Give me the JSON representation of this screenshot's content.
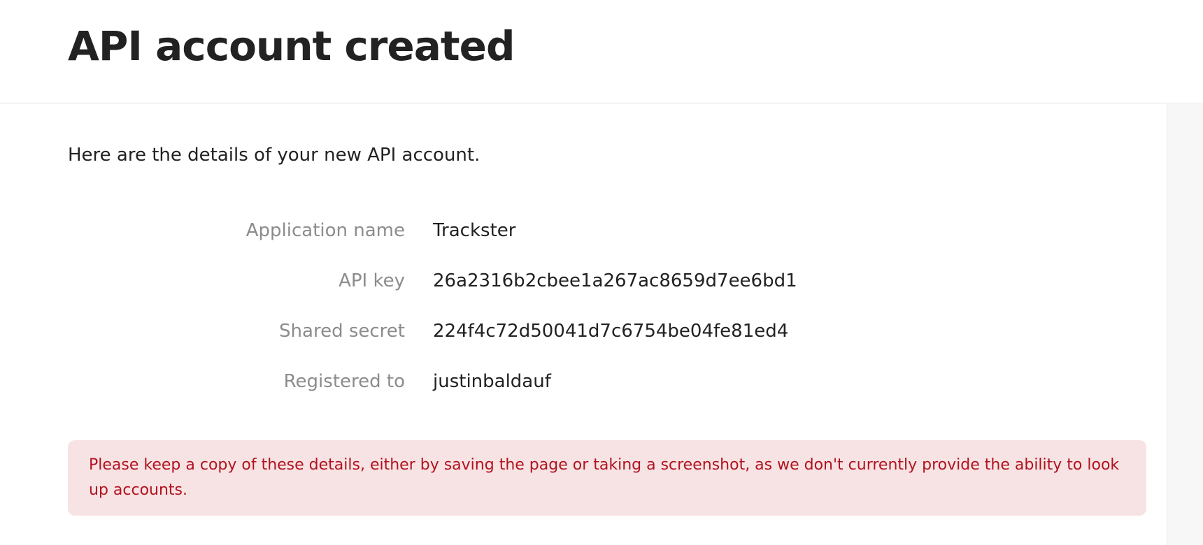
{
  "header": {
    "title": "API account created"
  },
  "intro": {
    "text": "Here are the details of your new API account."
  },
  "details": [
    {
      "label": "Application name",
      "value": "Trackster"
    },
    {
      "label": "API key",
      "value": "26a2316b2cbee1a267ac8659d7ee6bd1"
    },
    {
      "label": "Shared secret",
      "value": "224f4c72d50041d7c6754be04fe81ed4"
    },
    {
      "label": "Registered to",
      "value": "justinbaldauf"
    }
  ],
  "alert": {
    "text": "Please keep a copy of these details, either by saving the page or taking a screenshot, as we don't currently provide the ability to look up accounts."
  },
  "colors": {
    "alert_background": "#f8e3e4",
    "alert_text": "#b0131f",
    "label_text": "#8c8c8c"
  }
}
